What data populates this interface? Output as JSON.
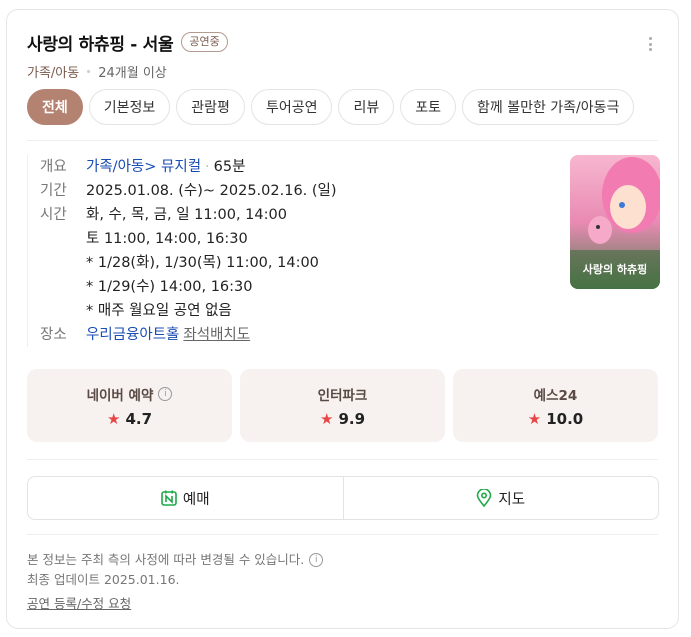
{
  "header": {
    "title": "사랑의 하츄핑 - 서울",
    "status": "공연중",
    "category": "가족/아동",
    "age": "24개월 이상"
  },
  "tabs": [
    {
      "label": "전체",
      "active": true
    },
    {
      "label": "기본정보"
    },
    {
      "label": "관람평"
    },
    {
      "label": "투어공연"
    },
    {
      "label": "리뷰"
    },
    {
      "label": "포토"
    },
    {
      "label": "함께 볼만한 가족/아동극"
    }
  ],
  "info": {
    "overview_label": "개요",
    "overview_genre": "가족/아동",
    "overview_sub": "> 뮤지컬",
    "overview_runtime": "65분",
    "period_label": "기간",
    "period_value": "2025.01.08. (수)~ 2025.02.16. (일)",
    "time_label": "시간",
    "time_lines": [
      "화, 수, 목, 금, 일 11:00, 14:00",
      "토 11:00, 14:00, 16:30",
      "* 1/28(화), 1/30(목) 11:00, 14:00",
      "* 1/29(수) 14:00, 16:30",
      "* 매주 월요일 공연 없음"
    ],
    "venue_label": "장소",
    "venue_value": "우리금융아트홀",
    "seat_map": "좌석배치도"
  },
  "poster": {
    "title_art": "사랑의 하츄핑",
    "colors": {
      "sky": "#f2a8c4",
      "hair": "#f07ab0",
      "bg": "#5d8a5a"
    }
  },
  "ratings": [
    {
      "name": "네이버 예약",
      "score": "4.7",
      "has_info": true
    },
    {
      "name": "인터파크",
      "score": "9.9"
    },
    {
      "name": "예스24",
      "score": "10.0"
    }
  ],
  "actions": {
    "reserve": "예매",
    "map": "지도"
  },
  "notice": {
    "line1": "본 정보는 주최 측의 사정에 따라 변경될 수 있습니다.",
    "line2": "최종 업데이트 2025.01.16.",
    "report": "공연 등록/수정 요청"
  }
}
